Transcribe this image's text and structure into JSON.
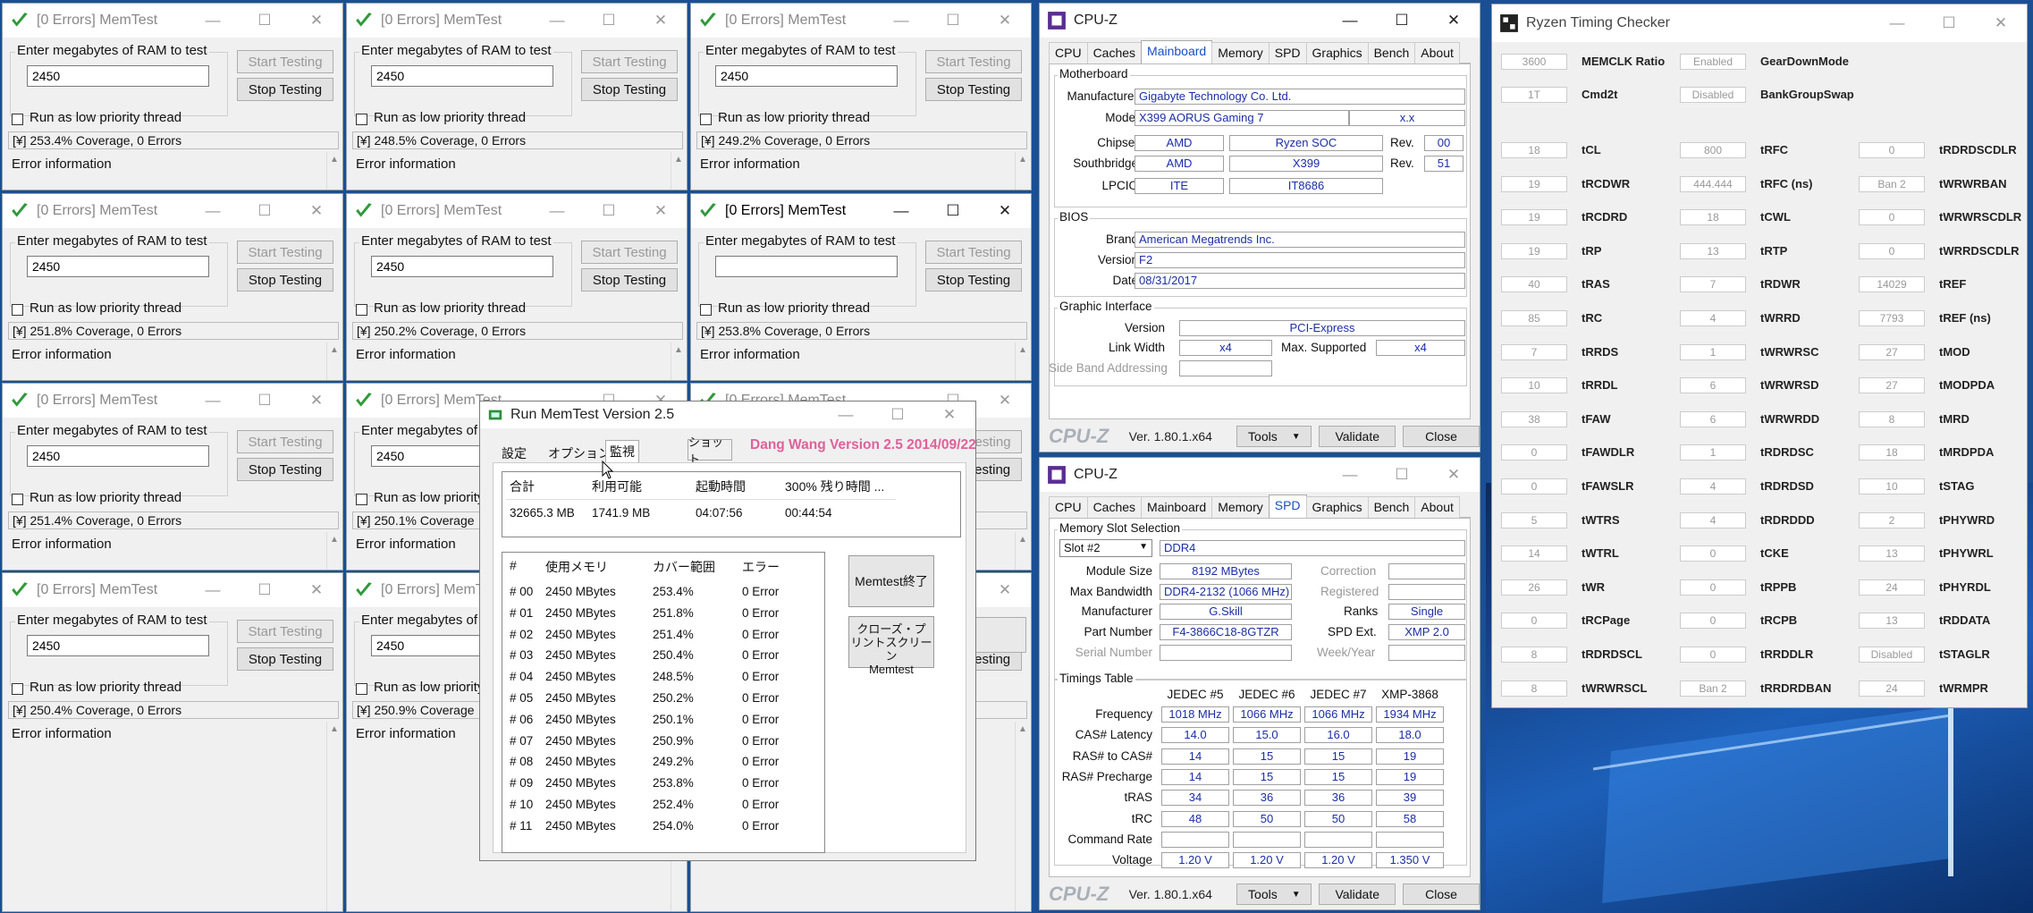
{
  "memtest": {
    "title": "[0 Errors] MemTest",
    "enter_label": "Enter megabytes of RAM to test",
    "start_label": "Start Testing",
    "stop_label": "Stop Testing",
    "low_priority_label": "Run as low priority thread",
    "error_info_label": "Error information",
    "windows": [
      {
        "value": "2450",
        "status": "[¥]  253.4% Coverage, 0 Errors"
      },
      {
        "value": "2450",
        "status": "[¥]  248.5% Coverage, 0 Errors"
      },
      {
        "value": "2450",
        "status": "[¥]  249.2% Coverage, 0 Errors"
      },
      {
        "value": "2450",
        "status": "[¥]  251.8% Coverage, 0 Errors"
      },
      {
        "value": "2450",
        "status": "[¥]  250.2% Coverage, 0 Errors"
      },
      {
        "value": "",
        "status": "[¥]  253.8% Coverage, 0 Errors"
      },
      {
        "value": "2450",
        "status": "[¥]  251.4% Coverage, 0 Errors"
      },
      {
        "value": "2450",
        "status": "[¥]  250.1% Coverage"
      },
      {
        "value": "",
        "status": ""
      },
      {
        "value": "2450",
        "status": "[¥]  250.4% Coverage, 0 Errors"
      },
      {
        "value": "2450",
        "status": "[¥]  250.9% Coverage"
      },
      {
        "value": "",
        "status": ""
      }
    ],
    "partial_titles": [
      "[0 Errors] MemTest",
      "[0 Errors] MemTest"
    ],
    "partial_start": "esting"
  },
  "runmemtest": {
    "title": "Run MemTest Version 2.5",
    "tabs": [
      "設定",
      "オプション",
      "監視"
    ],
    "shortcut_btn": "ショット",
    "version_text": "Dang Wang Version 2.5 2014/09/22",
    "summary_headers": [
      "合計",
      "利用可能",
      "起動時間",
      "300% 残り時間 ..."
    ],
    "summary_values": [
      "32665.3 MB",
      "1741.9 MB",
      "04:07:56",
      "00:44:54"
    ],
    "list_headers": [
      "#",
      "使用メモリ",
      "カバー範囲",
      "エラー"
    ],
    "rows": [
      [
        "# 00",
        "2450 MBytes",
        "253.4%",
        "0 Error"
      ],
      [
        "# 01",
        "2450 MBytes",
        "251.8%",
        "0 Error"
      ],
      [
        "# 02",
        "2450 MBytes",
        "251.4%",
        "0 Error"
      ],
      [
        "# 03",
        "2450 MBytes",
        "250.4%",
        "0 Error"
      ],
      [
        "# 04",
        "2450 MBytes",
        "248.5%",
        "0 Error"
      ],
      [
        "# 05",
        "2450 MBytes",
        "250.2%",
        "0 Error"
      ],
      [
        "# 06",
        "2450 MBytes",
        "250.1%",
        "0 Error"
      ],
      [
        "# 07",
        "2450 MBytes",
        "250.9%",
        "0 Error"
      ],
      [
        "# 08",
        "2450 MBytes",
        "249.2%",
        "0 Error"
      ],
      [
        "# 09",
        "2450 MBytes",
        "253.8%",
        "0 Error"
      ],
      [
        "# 10",
        "2450 MBytes",
        "252.4%",
        "0 Error"
      ],
      [
        "# 11",
        "2450 MBytes",
        "254.0%",
        "0 Error"
      ]
    ],
    "end_btn": "Memtest終了",
    "close_btn_line1": "クローズ・プ",
    "close_btn_line2": "リントスクリーン",
    "close_btn_line3": "Memtest"
  },
  "cpuz_common": {
    "title": "CPU-Z",
    "tabs": [
      "CPU",
      "Caches",
      "Mainboard",
      "Memory",
      "SPD",
      "Graphics",
      "Bench",
      "About"
    ],
    "logo": "CPU-Z",
    "version": "Ver. 1.80.1.x64",
    "tools": "Tools",
    "validate": "Validate",
    "close": "Close"
  },
  "cpuz_mb": {
    "motherboard_legend": "Motherboard",
    "manufacturer_label": "Manufacturer",
    "manufacturer": "Gigabyte Technology Co. Ltd.",
    "model_label": "Model",
    "model": "X399 AORUS Gaming 7",
    "model_rev": "x.x",
    "chipset_label": "Chipset",
    "chipset": "AMD",
    "chipset2": "Ryzen SOC",
    "rev_label": "Rev.",
    "chipset_rev": "00",
    "southbridge_label": "Southbridge",
    "sb": "AMD",
    "sb2": "X399",
    "sb_rev": "51",
    "lpcio_label": "LPCIO",
    "lpcio": "ITE",
    "lpcio2": "IT8686",
    "bios_legend": "BIOS",
    "brand_label": "Brand",
    "brand": "American Megatrends Inc.",
    "version_label": "Version",
    "bios_version": "F2",
    "date_label": "Date",
    "date": "08/31/2017",
    "gi_legend": "Graphic Interface",
    "gi_version_label": "Version",
    "gi_version": "PCI-Express",
    "linkwidth_label": "Link Width",
    "linkwidth": "x4",
    "maxsup_label": "Max. Supported",
    "maxsup": "x4",
    "sideband_label": "Side Band Addressing"
  },
  "cpuz_spd": {
    "slot_legend": "Memory Slot Selection",
    "slot": "Slot #2",
    "type": "DDR4",
    "module_size_label": "Module Size",
    "module_size": "8192 MBytes",
    "max_bw_label": "Max Bandwidth",
    "max_bw": "DDR4-2132 (1066 MHz)",
    "manufacturer_label": "Manufacturer",
    "manufacturer": "G.Skill",
    "part_label": "Part Number",
    "part": "F4-3866C18-8GTZR",
    "serial_label": "Serial Number",
    "correction_label": "Correction",
    "registered_label": "Registered",
    "ranks_label": "Ranks",
    "ranks": "Single",
    "spdext_label": "SPD Ext.",
    "spdext": "XMP 2.0",
    "weekyear_label": "Week/Year",
    "timings_legend": "Timings Table",
    "cols": [
      "JEDEC #5",
      "JEDEC #6",
      "JEDEC #7",
      "XMP-3868"
    ],
    "rows": [
      {
        "label": "Frequency",
        "vals": [
          "1018 MHz",
          "1066 MHz",
          "1066 MHz",
          "1934 MHz"
        ]
      },
      {
        "label": "CAS# Latency",
        "vals": [
          "14.0",
          "15.0",
          "16.0",
          "18.0"
        ]
      },
      {
        "label": "RAS# to CAS#",
        "vals": [
          "14",
          "15",
          "15",
          "19"
        ]
      },
      {
        "label": "RAS# Precharge",
        "vals": [
          "14",
          "15",
          "15",
          "19"
        ]
      },
      {
        "label": "tRAS",
        "vals": [
          "34",
          "36",
          "36",
          "39"
        ]
      },
      {
        "label": "tRC",
        "vals": [
          "48",
          "50",
          "50",
          "58"
        ]
      },
      {
        "label": "Command Rate",
        "vals": [
          "",
          "",
          "",
          ""
        ]
      },
      {
        "label": "Voltage",
        "vals": [
          "1.20 V",
          "1.20 V",
          "1.20 V",
          "1.350 V"
        ]
      }
    ]
  },
  "ryzen": {
    "title": "Ryzen Timing Checker",
    "top": [
      {
        "val": "3600",
        "label": "MEMCLK Ratio",
        "val2": "Enabled",
        "label2": "GearDownMode"
      },
      {
        "val": "1T",
        "label": "Cmd2t",
        "val2": "Disabled",
        "label2": "BankGroupSwap"
      }
    ],
    "rows": [
      [
        "18",
        "tCL",
        "800",
        "tRFC",
        "0",
        "tRDRDSCDLR"
      ],
      [
        "19",
        "tRCDWR",
        "444.444",
        "tRFC (ns)",
        "Ban 2",
        "tWRWRBAN"
      ],
      [
        "19",
        "tRCDRD",
        "18",
        "tCWL",
        "0",
        "tWRWRSCDLR"
      ],
      [
        "19",
        "tRP",
        "13",
        "tRTP",
        "0",
        "tWRRDSCDLR"
      ],
      [
        "40",
        "tRAS",
        "7",
        "tRDWR",
        "14029",
        "tREF"
      ],
      [
        "85",
        "tRC",
        "4",
        "tWRRD",
        "7793",
        "tREF (ns)"
      ],
      [
        "7",
        "tRRDS",
        "1",
        "tWRWRSC",
        "27",
        "tMOD"
      ],
      [
        "10",
        "tRRDL",
        "6",
        "tWRWRSD",
        "27",
        "tMODPDA"
      ],
      [
        "38",
        "tFAW",
        "6",
        "tWRWRDD",
        "8",
        "tMRD"
      ],
      [
        "0",
        "tFAWDLR",
        "1",
        "tRDRDSC",
        "18",
        "tMRDPDA"
      ],
      [
        "0",
        "tFAWSLR",
        "4",
        "tRDRDSD",
        "10",
        "tSTAG"
      ],
      [
        "5",
        "tWTRS",
        "4",
        "tRDRDDD",
        "2",
        "tPHYWRD"
      ],
      [
        "14",
        "tWTRL",
        "0",
        "tCKE",
        "13",
        "tPHYWRL"
      ],
      [
        "26",
        "tWR",
        "0",
        "tRPPB",
        "24",
        "tPHYRDL"
      ],
      [
        "0",
        "tRCPage",
        "0",
        "tRCPB",
        "13",
        "tRDDATA"
      ],
      [
        "8",
        "tRDRDSCL",
        "0",
        "tRRDDLR",
        "Disabled",
        "tSTAGLR"
      ],
      [
        "8",
        "tWRWRSCL",
        "Ban 2",
        "tRRDRDBAN",
        "24",
        "tWRMPR"
      ]
    ]
  }
}
